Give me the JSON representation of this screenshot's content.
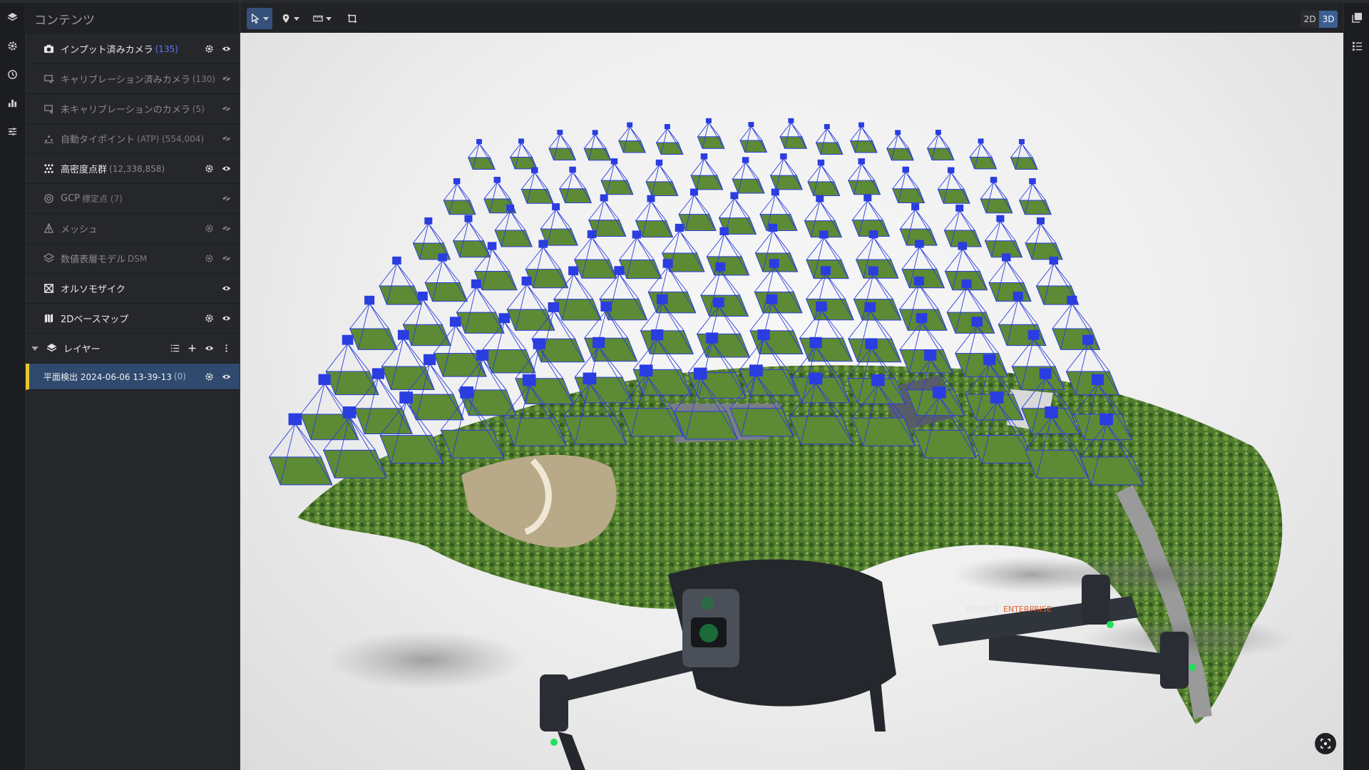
{
  "panel": {
    "title": "コンテンツ",
    "items": [
      {
        "label": "インプット済みカメラ",
        "count": "(135)"
      },
      {
        "label": "キャリブレーション済みカメラ",
        "count": "(130)"
      },
      {
        "label": "未キャリブレーションのカメラ",
        "count": "(5)"
      },
      {
        "label": "自動タイポイント",
        "count": "(ATP) (554,004)"
      },
      {
        "label": "高密度点群",
        "count": "(12,338,858)"
      },
      {
        "label": "GCP",
        "count": "標定点 (7)"
      },
      {
        "label": "メッシュ",
        "count": ""
      },
      {
        "label": "数値表層モデル",
        "count": "DSM"
      },
      {
        "label": "オルソモザイク",
        "count": ""
      },
      {
        "label": "2Dベースマップ",
        "count": ""
      }
    ],
    "layer": {
      "label": "レイヤー"
    },
    "sublayer": {
      "label": "平面検出 2024-06-06 13-39-13",
      "count": "(0)"
    }
  },
  "toolbar": {
    "mode_2d": "2D",
    "mode_3d": "3D",
    "active_mode": "3D"
  },
  "viewport": {
    "drone_model": "MAVIC 3",
    "drone_edition": "ENTERPRISE"
  },
  "colors": {
    "accent": "#3d5f94",
    "camera_frustum": "#2a3de0",
    "selected_marker": "#e8c72c",
    "count_highlight": "#5a7cff"
  }
}
